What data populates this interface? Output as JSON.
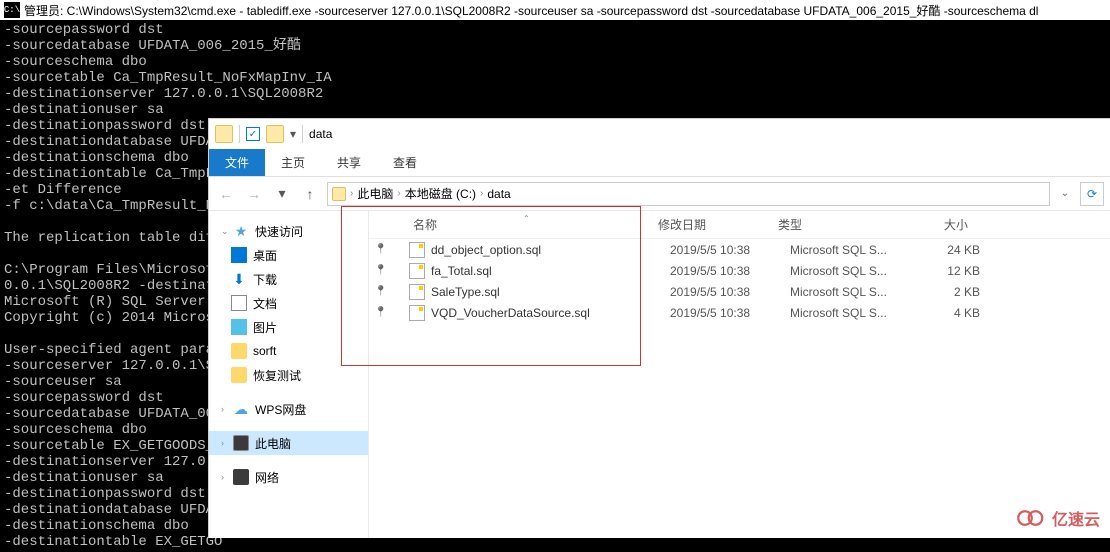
{
  "cmd": {
    "title_prefix": "管理员: C:\\Windows\\System32\\cmd.exe - tablediff.exe  -sourceserver 127.0.0.1\\SQL2008R2 -sourceuser sa -sourcepassword dst -sourcedatabase UFDATA_006_2015_好酷 -sourceschema dl",
    "body": "-sourcepassword dst\n-sourcedatabase UFDATA_006_2015_好酷\n-sourceschema dbo\n-sourcetable Ca_TmpResult_NoFxMapInv_IA\n-destinationserver 127.0.0.1\\SQL2008R2\n-destinationuser sa\n-destinationpassword dst\n-destinationdatabase UFDAT\n-destinationschema dbo\n-destinationtable Ca_TmpF\n-et Difference\n-f c:\\data\\Ca_TmpResult_Nc\n\nThe replication table diff\n\nC:\\Program Files\\Microsoft\n0.0.1\\SQL2008R2 -destinati\nMicrosoft (R) SQL Server R\nCopyright (c) 2014 Microsc\n\nUser-specified agent param\n-sourceserver 127.0.0.1\\SQ\n-sourceuser sa\n-sourcepassword dst\n-sourcedatabase UFDATA_006\n-sourceschema dbo\n-sourcetable EX_GETGOODS_D\n-destinationserver 127.0.0\n-destinationuser sa\n-destinationpassword dst\n-destinationdatabase UFDAT\n-destinationschema dbo\n-destinationtable EX_GETGO"
  },
  "explorer": {
    "title_text": "data",
    "tabs": {
      "file": "文件",
      "home": "主页",
      "share": "共享",
      "view": "查看"
    },
    "breadcrumb": {
      "pc": "此电脑",
      "drive": "本地磁盘 (C:)",
      "folder": "data"
    },
    "sidebar": {
      "quick": "快速访问",
      "desktop": "桌面",
      "downloads": "下载",
      "documents": "文档",
      "pictures": "图片",
      "sorft": "sorft",
      "recovery": "恢复测试",
      "wps": "WPS网盘",
      "pc": "此电脑",
      "network": "网络"
    },
    "columns": {
      "name": "名称",
      "date": "修改日期",
      "type": "类型",
      "size": "大小"
    },
    "files": [
      {
        "name": "dd_object_option.sql",
        "date": "2019/5/5 10:38",
        "type": "Microsoft SQL S...",
        "size": "24 KB"
      },
      {
        "name": "fa_Total.sql",
        "date": "2019/5/5 10:38",
        "type": "Microsoft SQL S...",
        "size": "12 KB"
      },
      {
        "name": "SaleType.sql",
        "date": "2019/5/5 10:38",
        "type": "Microsoft SQL S...",
        "size": "2 KB"
      },
      {
        "name": "VQD_VoucherDataSource.sql",
        "date": "2019/5/5 10:38",
        "type": "Microsoft SQL S...",
        "size": "4 KB"
      }
    ]
  },
  "watermark": "亿速云"
}
